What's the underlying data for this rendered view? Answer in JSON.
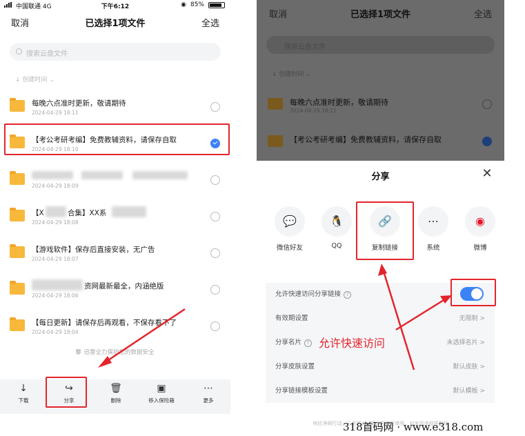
{
  "status": {
    "carrier": "中国联通 4G",
    "time": "下午6:12",
    "battery": "85%"
  },
  "nav": {
    "cancel": "取消",
    "title": "已选择1项文件",
    "select_all": "全选"
  },
  "search": {
    "placeholder": "搜索云盘文件"
  },
  "sort_label": "创建时间",
  "files": [
    {
      "title": "每晚六点准时更新，敬请期待",
      "date": "2024-04-29 18:11",
      "selected": false
    },
    {
      "title": "【考公考研考编】免费教辅资料，请保存自取",
      "date": "2024-04-29 18:10",
      "selected": true
    },
    {
      "title": "",
      "date": "2024-04-29 18:09",
      "selected": false
    },
    {
      "title_a": "【X",
      "title_b": "合集】XX系",
      "date": "2024-04-29 18:08",
      "selected": false
    },
    {
      "title": "【游戏软件】保存后直接安装，无广告",
      "date": "2024-04-29 18:07",
      "selected": false
    },
    {
      "title": "资网最新最全，内涵绝版",
      "date": "2024-04-29 18:06",
      "selected": false
    },
    {
      "title": "【每日更新】请保存后再观看，不保存看不了",
      "date": "2024-04-29 18:04",
      "selected": false
    }
  ],
  "safety_note": "迅雷全力保护您的数据安全",
  "toolbar": {
    "download": "下载",
    "share": "分享",
    "delete": "删除",
    "vault": "移入保险箱",
    "more": "更多"
  },
  "share_sheet": {
    "title": "分享",
    "options": {
      "wechat": "微信好友",
      "qq": "QQ",
      "copy_link": "复制链接",
      "system": "系统",
      "weibo": "微博"
    },
    "settings": {
      "quick_access": "允许快速访问分享链接",
      "validity": "有效期设置",
      "validity_value": "无限制 >",
      "card": "分享名片",
      "card_value": "未选择名片 >",
      "skin": "分享皮肤设置",
      "skin_value": "默认皮肤 >",
      "template": "分享链接模板设置",
      "template_value": "默认模板 >"
    },
    "quick_access_enabled": true,
    "footnote": "响应净网行动，云盘将对分享内容进行审核，如发现违规将删除"
  },
  "annotation": "允许快速访问",
  "watermark": "318首码网 · www.e318.com",
  "colors": {
    "accent": "#3b82f6",
    "highlight": "#e3242b",
    "folder": "#f7b83b"
  }
}
